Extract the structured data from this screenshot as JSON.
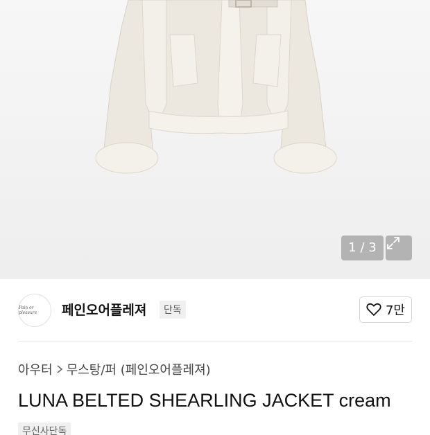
{
  "gallery": {
    "counter": "1 / 3"
  },
  "brand": {
    "logo_text": "Pain or pleasure",
    "name": "페인오어플레져",
    "badge": "단독",
    "likes": "7만"
  },
  "breadcrumb": {
    "category": "아우터",
    "subcategory": "무스탕/퍼",
    "brand_suffix": "(페인오어플레져)"
  },
  "product": {
    "title": "LUNA BELTED SHEARLING JACKET cream",
    "tag": "무신사단독"
  },
  "icons": {
    "expand": "expand-icon",
    "like": "heart-icon",
    "separator": "chevron-right-icon"
  },
  "colors": {
    "background": "#ffffff",
    "badge_bg": "#f0f0f0",
    "overlay": "#8a8a8a"
  }
}
